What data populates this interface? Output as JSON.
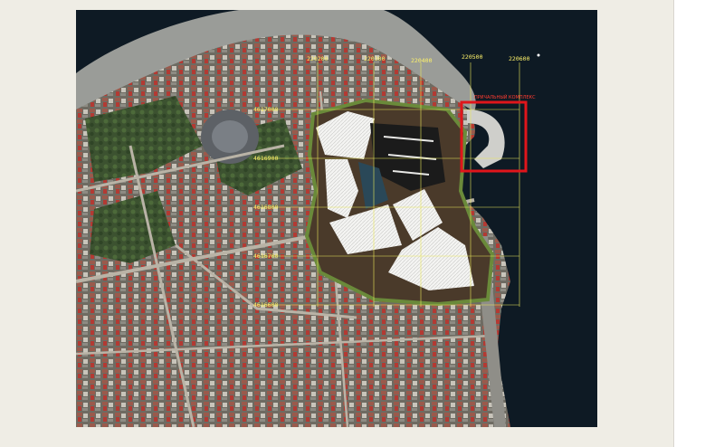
{
  "map": {
    "grid_x_labels": [
      "220200",
      "220300",
      "220400",
      "220500",
      "220600"
    ],
    "grid_y_labels": [
      "4617000",
      "4616900",
      "4616800",
      "4616700",
      "4616600"
    ],
    "highlight_label": "ПРИЧАЛЬНЫЙ КОМПЛЕКС",
    "colors": {
      "sea": "#0e1a24",
      "beach": "#9a9c98",
      "grid": "#e9e85a",
      "highlight": "#e0151b",
      "plan_fill": "#f1f1ef"
    }
  }
}
